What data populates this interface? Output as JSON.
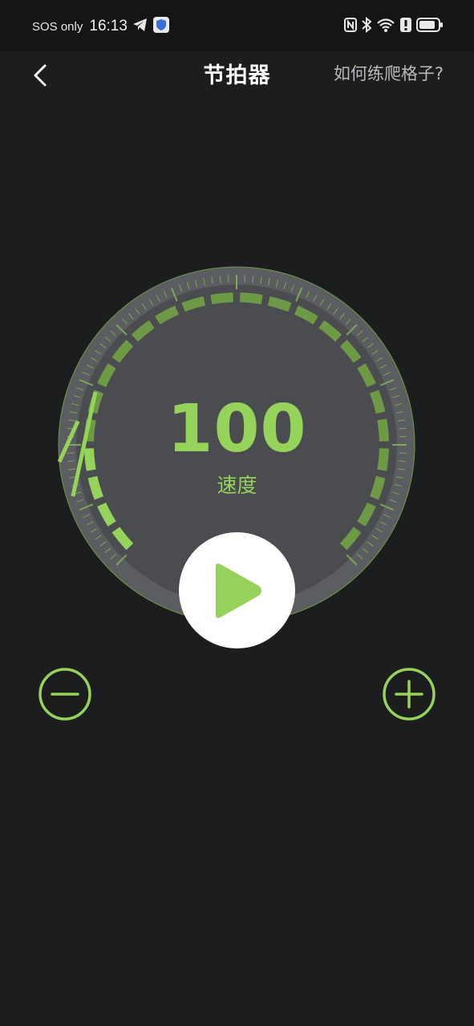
{
  "status_bar": {
    "carrier": "SOS only",
    "time": "16:13",
    "icons": [
      "telegram-icon",
      "shield-icon",
      "nfc-icon",
      "bluetooth-icon",
      "wifi-icon",
      "alert-icon",
      "battery-icon"
    ]
  },
  "app_bar": {
    "back_icon": "chevron-left-icon",
    "title": "节拍器",
    "help_link": "如何练爬格子?"
  },
  "metronome": {
    "bpm": "100",
    "bpm_label": "速度",
    "play_icon": "play-icon",
    "decrease_icon": "minus-circle-icon",
    "increase_icon": "plus-circle-icon",
    "tempo_level_fraction": 0.08
  },
  "colors": {
    "background": "#1c1d1f",
    "status_bar": "#141517",
    "accent": "#95d35a",
    "accent_dim": "#6f9a45",
    "dial_face": "#4b4c4f",
    "dial_rim": "#5c5d60"
  }
}
